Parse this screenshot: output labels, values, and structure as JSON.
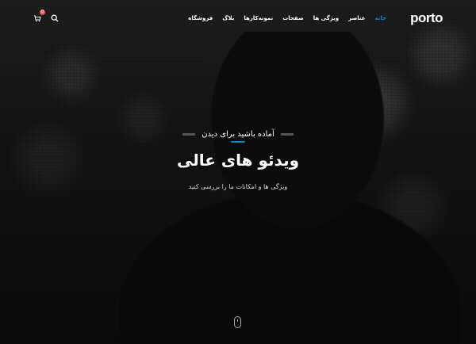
{
  "brand": {
    "logo_text": "porto"
  },
  "nav": {
    "items": [
      {
        "label": "خانه",
        "active": true
      },
      {
        "label": "عناصر"
      },
      {
        "label": "ویژگی ها"
      },
      {
        "label": "صفحات"
      },
      {
        "label": "نمونه‌کارها"
      },
      {
        "label": "بلاگ"
      },
      {
        "label": "فروشگاه"
      }
    ]
  },
  "header_tools": {
    "cart_badge": "0",
    "search_icon": "search-icon",
    "cart_icon": "cart-icon"
  },
  "hero": {
    "kicker": "آماده باشید برای دیدن",
    "title": "ویدئو های عالی",
    "subtitle": "ویژگی ها و امکانات ما را بررسی کنید",
    "scroll_icon": "mouse-scroll-icon"
  },
  "colors": {
    "accent": "#0088cc",
    "badge": "#e36159"
  }
}
